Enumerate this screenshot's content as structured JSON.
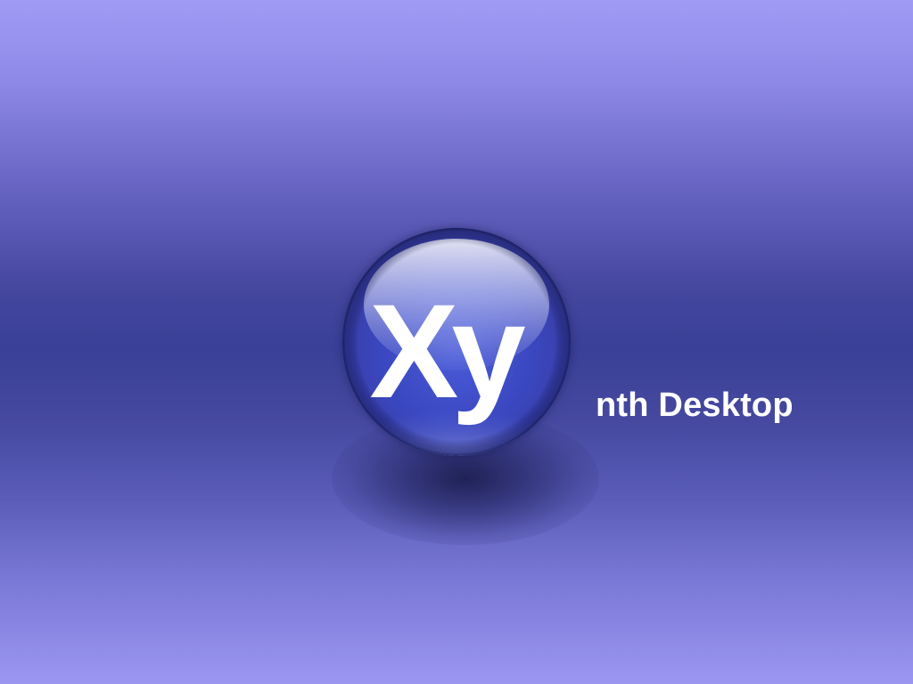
{
  "desktop": {
    "logo": {
      "monogram": "Xy",
      "icon": "xy-orb-logo-icon"
    },
    "caption": "nth Desktop"
  },
  "colors": {
    "background_top": "#a09cf5",
    "background_middle": "#3a4097",
    "orb_core": "#3c45b5",
    "text": "#ffffff"
  }
}
